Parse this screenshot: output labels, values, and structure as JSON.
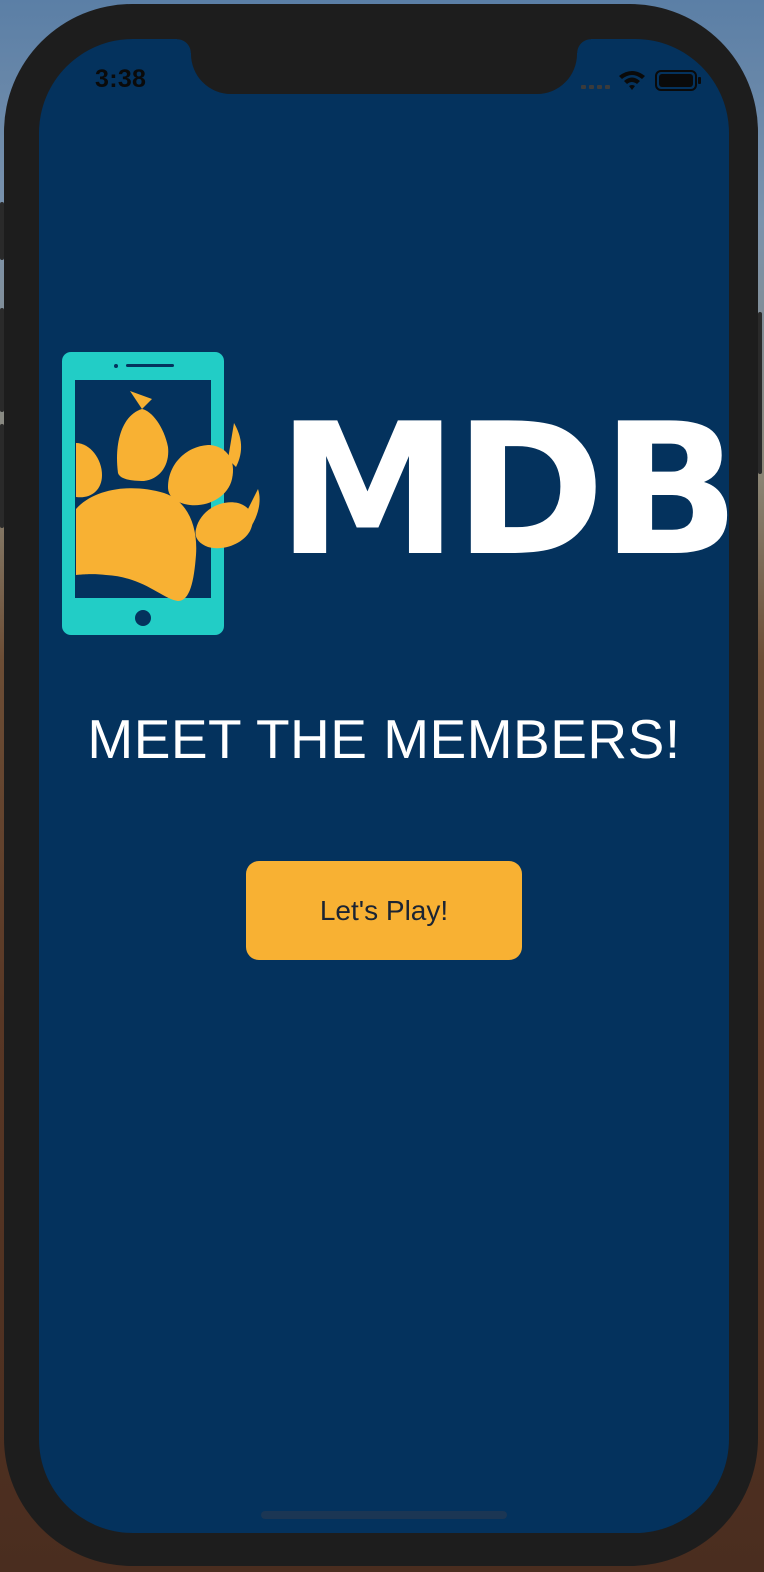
{
  "status_bar": {
    "time": "3:38",
    "icons": [
      "signal-icon",
      "wifi-icon",
      "battery-icon"
    ]
  },
  "logo": {
    "text": "MDB",
    "icon": "phone-paw-icon",
    "colors": {
      "phone": "#22cdc6",
      "paw": "#f8b133",
      "text": "#ffffff"
    }
  },
  "headline": "MEET THE MEMBERS!",
  "primary_button": {
    "label": "Let's Play!",
    "color": "#f8b133"
  },
  "theme": {
    "background": "#04325d",
    "device_frame": "#1d1d1d"
  }
}
